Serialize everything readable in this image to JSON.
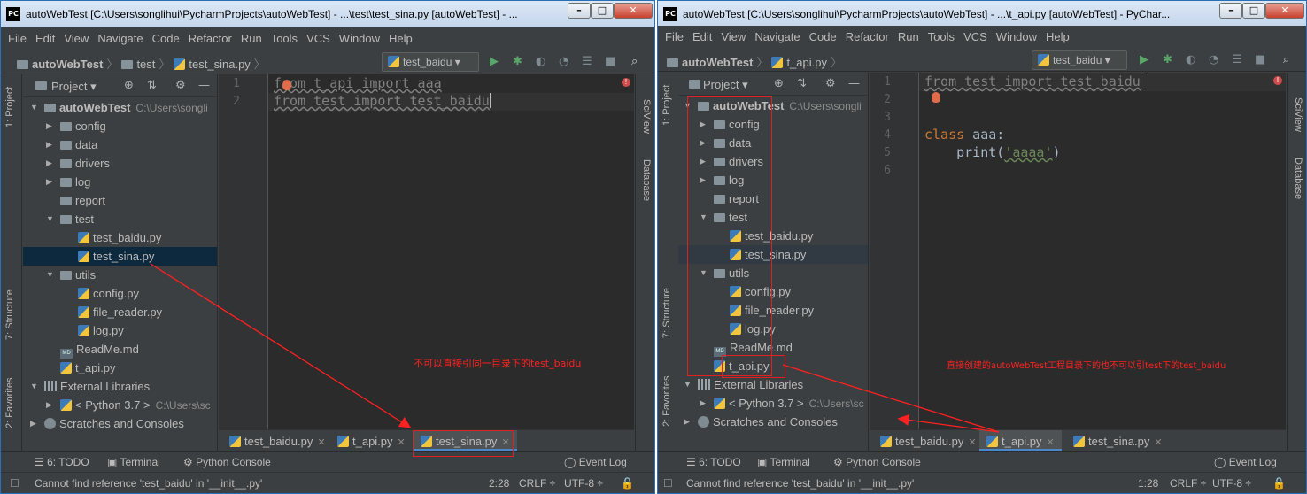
{
  "left": {
    "title": "autoWebTest [C:\\Users\\songlihui\\PycharmProjects\\autoWebTest] - ...\\test\\test_sina.py [autoWebTest] - ...",
    "menu": [
      "File",
      "Edit",
      "View",
      "Navigate",
      "Code",
      "Refactor",
      "Run",
      "Tools",
      "VCS",
      "Window",
      "Help"
    ],
    "breadcrumb": {
      "project": "autoWebTest",
      "folder": "test",
      "file": "test_sina.py"
    },
    "run_config": "test_baidu",
    "project_label": "Project",
    "side_left": {
      "project": "1: Project",
      "structure": "7: Structure",
      "favorites": "2: Favorites"
    },
    "side_right": {
      "sciview": "SciView",
      "database": "Database"
    },
    "tree": {
      "root": "autoWebTest",
      "root_path": "C:\\Users\\songli",
      "config": "config",
      "data": "data",
      "drivers": "drivers",
      "log": "log",
      "report": "report",
      "test": "test",
      "test_baidu": "test_baidu.py",
      "test_sina": "test_sina.py",
      "utils": "utils",
      "config_py": "config.py",
      "file_reader": "file_reader.py",
      "log_py": "log.py",
      "readme": "ReadMe.md",
      "t_api": "t_api.py",
      "ext_lib": "External Libraries",
      "python": "< Python 3.7 >",
      "python_path": "C:\\Users\\sc",
      "scratches": "Scratches and Consoles"
    },
    "code": {
      "line1": "from t_api import aaa",
      "line2": "from test import test_baidu"
    },
    "line_numbers": [
      "1",
      "2"
    ],
    "tabs": [
      "test_baidu.py",
      "t_api.py",
      "test_sina.py"
    ],
    "toolwins": {
      "todo": "6: TODO",
      "terminal": "Terminal",
      "console": "Python Console",
      "eventlog": "Event Log"
    },
    "status": {
      "message": "Cannot find reference 'test_baidu' in '__init__.py'",
      "pos": "2:28",
      "crlf": "CRLF",
      "enc": "UTF-8"
    },
    "annotation": "不可以直接引同一目录下的test_baidu"
  },
  "right": {
    "title": "autoWebTest [C:\\Users\\songlihui\\PycharmProjects\\autoWebTest] - ...\\t_api.py [autoWebTest] - PyChar...",
    "menu": [
      "File",
      "Edit",
      "View",
      "Navigate",
      "Code",
      "Refactor",
      "Run",
      "Tools",
      "VCS",
      "Window",
      "Help"
    ],
    "breadcrumb": {
      "project": "autoWebTest",
      "file": "t_api.py"
    },
    "run_config": "test_baidu",
    "project_label": "Project",
    "side_left": {
      "project": "1: Project",
      "structure": "7: Structure",
      "favorites": "2: Favorites"
    },
    "side_right": {
      "sciview": "SciView",
      "database": "Database"
    },
    "tree": {
      "root": "autoWebTest",
      "root_path": "C:\\Users\\songli",
      "config": "config",
      "data": "data",
      "drivers": "drivers",
      "log": "log",
      "report": "report",
      "test": "test",
      "test_baidu": "test_baidu.py",
      "test_sina": "test_sina.py",
      "utils": "utils",
      "config_py": "config.py",
      "file_reader": "file_reader.py",
      "log_py": "log.py",
      "readme": "ReadMe.md",
      "t_api": "t_api.py",
      "ext_lib": "External Libraries",
      "python": "< Python 3.7 >",
      "python_path": "C:\\Users\\sc",
      "scratches": "Scratches and Consoles"
    },
    "code": {
      "line1": "from test import test_baidu",
      "class_kw": "class",
      "class_name": " aaa:",
      "print_pre": "    print(",
      "print_str": "'aaaa'",
      "print_post": ")"
    },
    "line_numbers": [
      "1",
      "2",
      "3",
      "4",
      "5",
      "6"
    ],
    "tabs": [
      "test_baidu.py",
      "t_api.py",
      "test_sina.py"
    ],
    "toolwins": {
      "todo": "6: TODO",
      "terminal": "Terminal",
      "console": "Python Console",
      "eventlog": "Event Log"
    },
    "status": {
      "message": "Cannot find reference 'test_baidu' in '__init__.py'",
      "pos": "1:28",
      "crlf": "CRLF",
      "enc": "UTF-8"
    },
    "annotation": "直接创建的autoWebTest工程目录下的也不可以引test下的test_baidu"
  },
  "colors": {
    "accent": "#4a88c7",
    "annotation": "#ff2020",
    "keyword": "#cc7832",
    "string": "#6a8759"
  },
  "icons": [
    "pycharm-logo-icon",
    "folder-icon",
    "python-file-icon",
    "run-icon",
    "debug-icon",
    "search-icon",
    "gear-icon",
    "close-icon",
    "bulb-icon"
  ]
}
